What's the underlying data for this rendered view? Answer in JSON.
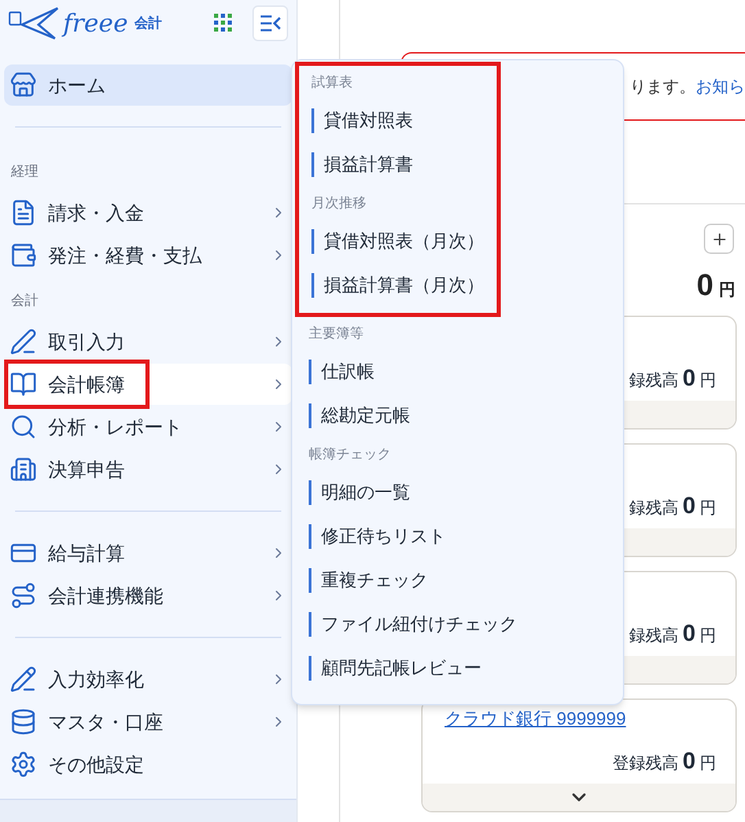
{
  "logo": {
    "brand": "freee",
    "product": "会計"
  },
  "sidebar": {
    "items": [
      {
        "kind": "item",
        "label": "ホーム",
        "selected": true,
        "submenu": false,
        "highlighted": false
      },
      {
        "kind": "divider"
      },
      {
        "kind": "heading",
        "label": "経理"
      },
      {
        "kind": "item",
        "label": "請求・入金",
        "selected": false,
        "submenu": true,
        "highlighted": false
      },
      {
        "kind": "item",
        "label": "発注・経費・支払",
        "selected": false,
        "submenu": true,
        "highlighted": false
      },
      {
        "kind": "heading",
        "label": "会計"
      },
      {
        "kind": "item",
        "label": "取引入力",
        "selected": false,
        "submenu": true,
        "highlighted": false
      },
      {
        "kind": "item",
        "label": "会計帳簿",
        "selected": false,
        "submenu": true,
        "highlighted": true
      },
      {
        "kind": "item",
        "label": "分析・レポート",
        "selected": false,
        "submenu": true,
        "highlighted": false
      },
      {
        "kind": "item",
        "label": "決算申告",
        "selected": false,
        "submenu": true,
        "highlighted": false
      },
      {
        "kind": "divider"
      },
      {
        "kind": "item",
        "label": "給与計算",
        "selected": false,
        "submenu": true,
        "highlighted": false
      },
      {
        "kind": "item",
        "label": "会計連携機能",
        "selected": false,
        "submenu": true,
        "highlighted": false
      },
      {
        "kind": "divider"
      },
      {
        "kind": "item",
        "label": "入力効率化",
        "selected": false,
        "submenu": true,
        "highlighted": false
      },
      {
        "kind": "item",
        "label": "マスタ・口座",
        "selected": false,
        "submenu": true,
        "highlighted": false
      },
      {
        "kind": "item",
        "label": "その他設定",
        "selected": false,
        "submenu": false,
        "highlighted": false
      }
    ]
  },
  "submenu": {
    "groups": [
      {
        "heading": "試算表",
        "highlighted": true,
        "items": [
          "貸借対照表",
          "損益計算書"
        ]
      },
      {
        "heading": "月次推移",
        "highlighted": true,
        "items": [
          "貸借対照表（月次）",
          "損益計算書（月次）"
        ]
      },
      {
        "heading": "主要簿等",
        "highlighted": false,
        "items": [
          "仕訳帳",
          "総勘定元帳"
        ]
      },
      {
        "heading": "帳簿チェック",
        "highlighted": false,
        "items": [
          "明細の一覧",
          "修正待ちリスト",
          "重複チェック",
          "ファイル紐付けチェック",
          "顧問先記帳レビュー"
        ]
      }
    ]
  },
  "notice": {
    "text": "ります。",
    "link": "お知ら"
  },
  "total": {
    "amount": "0",
    "unit": "円"
  },
  "accounts": [
    {
      "label": "録残高",
      "amount": "0",
      "unit": "円"
    },
    {
      "label": "録残高",
      "amount": "0",
      "unit": "円"
    },
    {
      "label": "録残高",
      "amount": "0",
      "unit": "円"
    },
    {
      "name": "クラウド銀行 9999999",
      "label": "登録残高",
      "amount": "0",
      "unit": "円",
      "expand": true
    }
  ]
}
